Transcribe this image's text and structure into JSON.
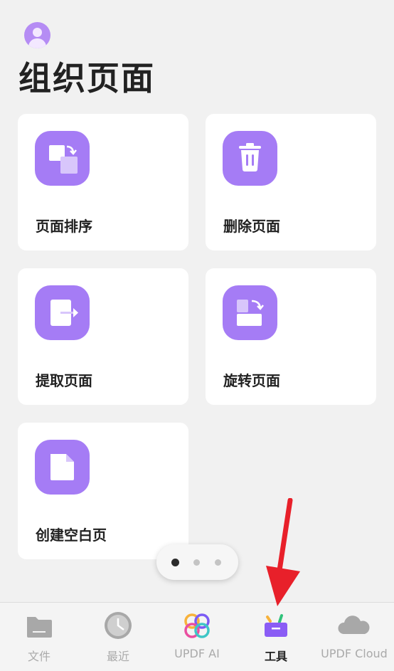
{
  "page": {
    "title": "组织页面"
  },
  "cards": [
    {
      "label": "页面排序",
      "icon": "reorder-pages-icon"
    },
    {
      "label": "删除页面",
      "icon": "trash-icon"
    },
    {
      "label": "提取页面",
      "icon": "extract-page-icon"
    },
    {
      "label": "旋转页面",
      "icon": "rotate-page-icon"
    },
    {
      "label": "创建空白页",
      "icon": "blank-page-icon"
    }
  ],
  "pager": {
    "page_count": 3,
    "current_index": 0
  },
  "nav": [
    {
      "label": "文件",
      "icon": "folder-icon",
      "active": false
    },
    {
      "label": "最近",
      "icon": "clock-icon",
      "active": false
    },
    {
      "label": "UPDF AI",
      "icon": "updf-ai-icon",
      "active": false
    },
    {
      "label": "工具",
      "icon": "toolbox-icon",
      "active": true
    },
    {
      "label": "UPDF Cloud",
      "icon": "cloud-icon",
      "active": false
    }
  ],
  "colors": {
    "accent": "#a57cf5",
    "annotation_arrow": "#e8202a"
  }
}
